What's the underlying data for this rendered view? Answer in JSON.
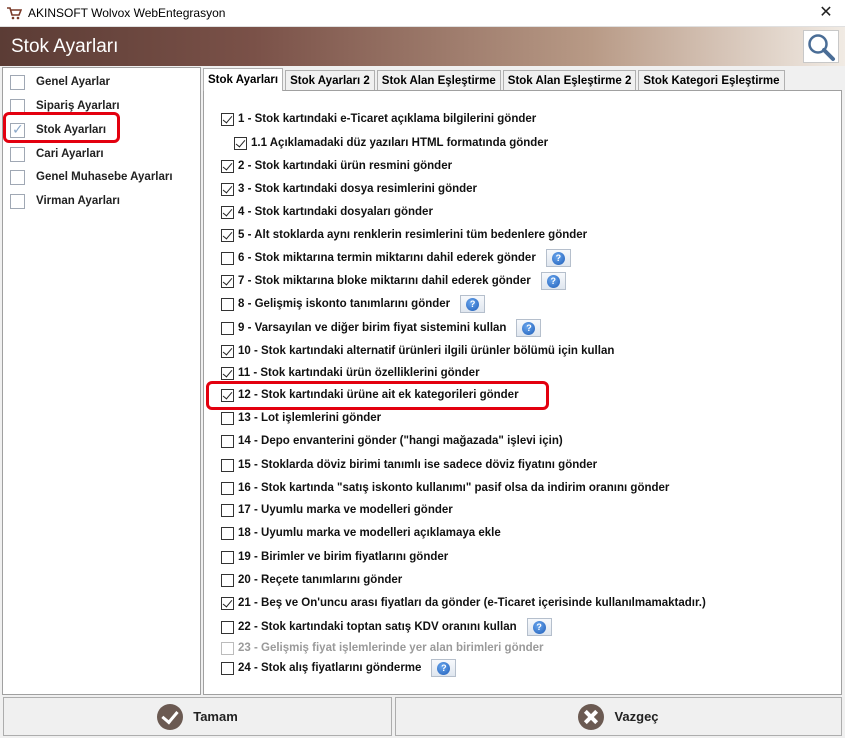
{
  "window": {
    "title": "AKINSOFT Wolvox WebEntegrasyon",
    "close_glyph": "✕"
  },
  "header": {
    "title": "Stok Ayarları",
    "search_icon": "search-icon"
  },
  "sidebar": {
    "items": [
      {
        "label": "Genel Ayarlar",
        "checked": false
      },
      {
        "label": "Sipariş Ayarları",
        "checked": false
      },
      {
        "label": "Stok Ayarları",
        "checked": true
      },
      {
        "label": "Cari Ayarları",
        "checked": false
      },
      {
        "label": "Genel Muhasebe Ayarları",
        "checked": false
      },
      {
        "label": "Virman Ayarları",
        "checked": false
      }
    ]
  },
  "tabs": [
    {
      "label": "Stok Ayarları",
      "active": true
    },
    {
      "label": "Stok Ayarları 2",
      "active": false
    },
    {
      "label": "Stok Alan Eşleştirme",
      "active": false
    },
    {
      "label": "Stok Alan Eşleştirme 2",
      "active": false
    },
    {
      "label": "Stok Kategori Eşleştirme",
      "active": false
    }
  ],
  "options": [
    {
      "label": "1 - Stok kartındaki e-Ticaret açıklama bilgilerini gönder",
      "checked": true,
      "help": false,
      "disabled": false
    },
    {
      "label": "1.1 Açıklamadaki düz yazıları HTML formatında gönder",
      "checked": true,
      "help": false,
      "disabled": false
    },
    {
      "label": "2 - Stok kartındaki ürün resmini gönder",
      "checked": true,
      "help": false,
      "disabled": false
    },
    {
      "label": "3 - Stok kartındaki dosya resimlerini gönder",
      "checked": true,
      "help": false,
      "disabled": false
    },
    {
      "label": "4 - Stok kartındaki dosyaları gönder",
      "checked": true,
      "help": false,
      "disabled": false
    },
    {
      "label": "5 - Alt stoklarda aynı renklerin resimlerini tüm bedenlere gönder",
      "checked": true,
      "help": false,
      "disabled": false
    },
    {
      "label": "6 - Stok miktarına termin miktarını dahil ederek gönder",
      "checked": false,
      "help": true,
      "disabled": false
    },
    {
      "label": "7 - Stok miktarına bloke miktarını dahil ederek gönder",
      "checked": true,
      "help": true,
      "disabled": false
    },
    {
      "label": "8 - Gelişmiş iskonto tanımlarını gönder",
      "checked": false,
      "help": true,
      "disabled": false
    },
    {
      "label": "9 - Varsayılan ve diğer birim fiyat sistemini kullan",
      "checked": false,
      "help": true,
      "disabled": false
    },
    {
      "label": "10 - Stok kartındaki alternatif ürünleri ilgili ürünler bölümü için kullan",
      "checked": true,
      "help": false,
      "disabled": false
    },
    {
      "label": "11 - Stok kartındaki ürün özelliklerini gönder",
      "checked": true,
      "help": false,
      "disabled": false
    },
    {
      "label": "12 - Stok kartındaki ürüne ait ek kategorileri gönder",
      "checked": true,
      "help": false,
      "disabled": false
    },
    {
      "label": "13 - Lot işlemlerini gönder",
      "checked": false,
      "help": false,
      "disabled": false
    },
    {
      "label": "14 - Depo envanterini gönder (\"hangi mağazada\" işlevi için)",
      "checked": false,
      "help": false,
      "disabled": false
    },
    {
      "label": "15 - Stoklarda döviz birimi tanımlı ise sadece döviz fiyatını gönder",
      "checked": false,
      "help": false,
      "disabled": false
    },
    {
      "label": "16 - Stok kartında \"satış iskonto kullanımı\" pasif olsa da indirim oranını gönder",
      "checked": false,
      "help": false,
      "disabled": false
    },
    {
      "label": "17 - Uyumlu marka ve modelleri gönder",
      "checked": false,
      "help": false,
      "disabled": false
    },
    {
      "label": "18 - Uyumlu marka ve modelleri açıklamaya ekle",
      "checked": false,
      "help": false,
      "disabled": false
    },
    {
      "label": "19 - Birimler ve birim fiyatlarını gönder",
      "checked": false,
      "help": false,
      "disabled": false
    },
    {
      "label": "20 - Reçete tanımlarını gönder",
      "checked": false,
      "help": false,
      "disabled": false
    },
    {
      "label": "21 - Beş ve On'uncu arası fiyatları da gönder (e-Ticaret içerisinde kullanılmamaktadır.)",
      "checked": true,
      "help": false,
      "disabled": false
    },
    {
      "label": "22 - Stok kartındaki toptan satış KDV oranını kullan",
      "checked": false,
      "help": true,
      "disabled": false
    },
    {
      "label": "23 - Gelişmiş fiyat işlemlerinde yer alan birimleri gönder",
      "checked": false,
      "help": false,
      "disabled": true
    },
    {
      "label": "24 - Stok alış fiyatlarını gönderme",
      "checked": false,
      "help": true,
      "disabled": false
    }
  ],
  "buttons": {
    "ok_label": "Tamam",
    "cancel_label": "Vazgeç"
  },
  "colors": {
    "header_dark": "#5b3c35",
    "highlight": "#e3000f",
    "help_blue": "#1f5db8"
  }
}
